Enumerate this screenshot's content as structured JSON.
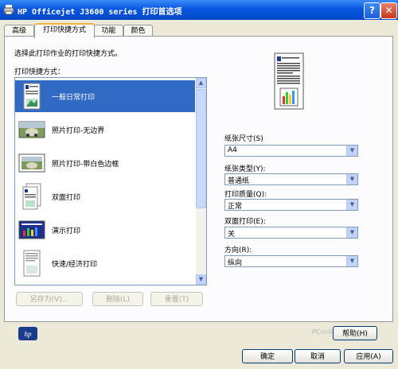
{
  "window": {
    "title": "HP Officejet J3600 series 打印首选项",
    "help_btn": "?",
    "close_btn": "✕"
  },
  "tabs": [
    {
      "label": "高级"
    },
    {
      "label": "打印快捷方式"
    },
    {
      "label": "功能"
    },
    {
      "label": "颜色"
    }
  ],
  "shortcuts": {
    "instruction": "选择此打印作业的打印快捷方式。",
    "list_label": "打印快捷方式：",
    "items": [
      {
        "label": "一般日常打印",
        "selected": true,
        "icon": "document-icon"
      },
      {
        "label": "照片打印-无边界",
        "icon": "photo-borderless-icon"
      },
      {
        "label": "照片打印-带白色边框",
        "icon": "photo-border-icon"
      },
      {
        "label": "双面打印",
        "icon": "duplex-icon"
      },
      {
        "label": "演示打印",
        "icon": "presentation-icon"
      },
      {
        "label": "快速/经济打印",
        "icon": "fast-economy-icon"
      }
    ],
    "save_as": "另存为(V)...",
    "delete": "删除(L)",
    "reset": "重置(T)"
  },
  "settings": {
    "paper_size": {
      "label": "纸张尺寸(S)",
      "value": "A4"
    },
    "paper_type": {
      "label": "纸张类型(Y):",
      "value": "普通纸"
    },
    "print_quality": {
      "label": "打印质量(Q):",
      "value": "正常"
    },
    "duplex": {
      "label": "双面打印(E):",
      "value": "关"
    },
    "orientation": {
      "label": "方向(R):",
      "value": "纵向"
    }
  },
  "buttons": {
    "help": "帮助(H)",
    "ok": "确定",
    "cancel": "取消",
    "apply": "应用(A)"
  },
  "brand": {
    "logo_text": "hp",
    "watermark": "PConline"
  },
  "colors": {
    "titlebar": "#0A5BE2",
    "selection": "#316AC5",
    "face": "#ECE9D8"
  }
}
